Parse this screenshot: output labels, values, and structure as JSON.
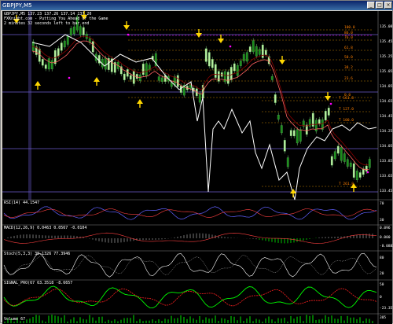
{
  "window": {
    "title": "GBPJPY,M5",
    "min_label": "_",
    "max_label": "□",
    "close_label": "×"
  },
  "header": {
    "line1": "GBPJPY,M5  137.23 137.26 137.14 137.20",
    "line2": "FXKnight.com - Putting You Ahead of the Game",
    "line3": "2 minutes 32 seconds left to bar end"
  },
  "main_axis": {
    "ticks": [
      "135.08",
      "135.45",
      "135.25",
      "135.05",
      "134.85",
      "134.65",
      "134.45",
      "134.25",
      "134.05",
      "133.85",
      "133.65",
      "133.45"
    ]
  },
  "fib_levels": [
    "100.0",
    "86.0",
    "76.0",
    "61.8",
    "50.0",
    "38.2",
    "23.6",
    "0.0",
    "T 161.8",
    "T 127.0",
    "T 100.0",
    "T 261.8"
  ],
  "panes": {
    "rsi": {
      "label": "RSI(14) 44.1547",
      "ticks": [
        "70",
        "30"
      ]
    },
    "macd": {
      "label": "MACD(12,26,9) 0.0463 0.0567 -0.0104",
      "ticks": [
        "0.096",
        "0.000",
        "-0.0882"
      ]
    },
    "stoch": {
      "label": "Stoch(5,3,3) 39.1326 77.3946",
      "ticks": [
        "80",
        "20"
      ]
    },
    "signal": {
      "label": "SIGNAL_PRO(67 63.3518 -8.6657",
      "ticks": [
        "50",
        "0",
        "-23.3574"
      ]
    },
    "volume": {
      "label": "Volume 67",
      "ticks": [
        "305"
      ]
    }
  },
  "colors": {
    "candle_up": "#b8f0a0",
    "candle_down": "#1a8c1a",
    "ma_fast": "#8b0000",
    "ma_slow": "#ff6060",
    "fib_line": "#c08000",
    "fib_100": "#ff00ff",
    "signal_line": "#ffffff",
    "blue_line": "#6a5acd",
    "arrow_yellow": "#ffd700",
    "arrow_magenta": "#ff00ff"
  }
}
